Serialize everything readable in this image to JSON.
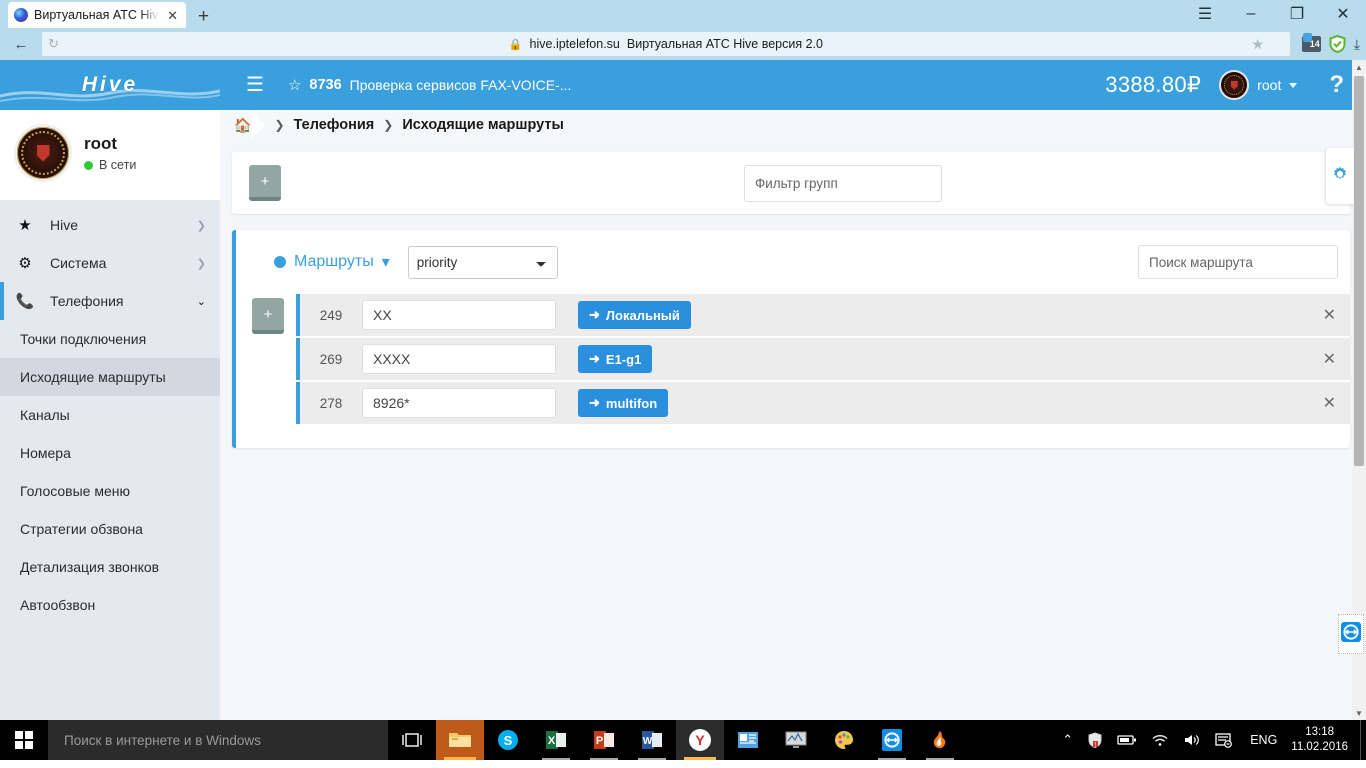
{
  "browser": {
    "tab": {
      "title": "Виртуальная АТС Hive ве",
      "close_label": "✕",
      "favicon": "globe-icon"
    },
    "newtab_label": "+",
    "window_controls": {
      "menu": "☰",
      "minimize": "–",
      "restore": "❐",
      "close": "✕"
    },
    "nav": {
      "back": "←",
      "reload": "↻"
    },
    "url": "hive.iptelefon.su",
    "page_title": "Виртуальная АТС Hive версия 2.0",
    "lock_icon": "lock-icon",
    "bookmark_star": "★",
    "extensions": {
      "badge_count": "14",
      "adblock": "adblock-shield-icon",
      "download": "download-icon"
    }
  },
  "sidebar": {
    "logo": "Hive",
    "profile": {
      "name": "root",
      "status": "В сети"
    },
    "nav": [
      {
        "label": "Hive",
        "icon": "star-icon",
        "arrow": "❯"
      },
      {
        "label": "Система",
        "icon": "gears-icon",
        "arrow": "❯"
      },
      {
        "label": "Телефония",
        "icon": "phone-icon",
        "arrow": "❯"
      }
    ],
    "sub_items": [
      {
        "label": "Точки подключения"
      },
      {
        "label": "Исходящие маршруты"
      },
      {
        "label": "Каналы"
      },
      {
        "label": "Номера"
      },
      {
        "label": "Голосовые меню"
      },
      {
        "label": "Стратегии обзвона"
      },
      {
        "label": "Детализация звонков"
      },
      {
        "label": "Автообзвон"
      }
    ]
  },
  "topbar": {
    "burger": "☰",
    "star": "☆",
    "number": "8736",
    "description": "Проверка сервисов FAX-VOICE-...",
    "balance": "3388.80₽",
    "user": "root",
    "help": "?"
  },
  "breadcrumb": {
    "home_icon": "home-icon",
    "sep": "❯",
    "parent": "Телефония",
    "current": "Исходящие маршруты"
  },
  "filter_panel": {
    "add_label": "+",
    "group_filter_placeholder": "Фильтр групп",
    "group_filter_value": ""
  },
  "routes": {
    "title": "Маршруты",
    "title_caret": "▾",
    "sort_value": "priority",
    "sort_options": [
      "priority"
    ],
    "search_placeholder": "Поиск маршрута",
    "search_value": "",
    "add_label": "+",
    "close_label": "✕",
    "rows": [
      {
        "id": "249",
        "pattern": "XX",
        "destination": "Локальный"
      },
      {
        "id": "269",
        "pattern": "XXXX",
        "destination": "E1-g1"
      },
      {
        "id": "278",
        "pattern": "8926*",
        "destination": "multifon"
      }
    ]
  },
  "side_widgets": {
    "gear_tab": "gear-icon",
    "teamviewer_tab": "teamviewer-icon"
  },
  "taskbar": {
    "start": "windows-logo-icon",
    "search_placeholder": "Поиск в интернете и в Windows",
    "icons": [
      {
        "name": "task-view-icon",
        "glyph": "❐"
      },
      {
        "name": "file-explorer-icon",
        "glyph": "📁"
      },
      {
        "name": "skype-icon",
        "glyph": "S"
      },
      {
        "name": "excel-icon",
        "glyph": "X"
      },
      {
        "name": "powerpoint-icon",
        "glyph": "P"
      },
      {
        "name": "word-icon",
        "glyph": "W"
      },
      {
        "name": "yandex-browser-icon",
        "glyph": "Y"
      },
      {
        "name": "contacts-icon",
        "glyph": "▤"
      },
      {
        "name": "monitor-icon",
        "glyph": "🖵"
      },
      {
        "name": "paint-icon",
        "glyph": "🎨"
      },
      {
        "name": "teamviewer-icon",
        "glyph": "↔"
      },
      {
        "name": "flame-icon",
        "glyph": "🔥"
      }
    ],
    "tray": {
      "expand": "⌃",
      "security": "security-shield-icon",
      "battery": "battery-icon",
      "wifi": "wifi-icon",
      "volume": "volume-icon",
      "action_center": "action-center-icon",
      "language": "ENG",
      "time": "13:18",
      "date": "11.02.2016"
    }
  }
}
